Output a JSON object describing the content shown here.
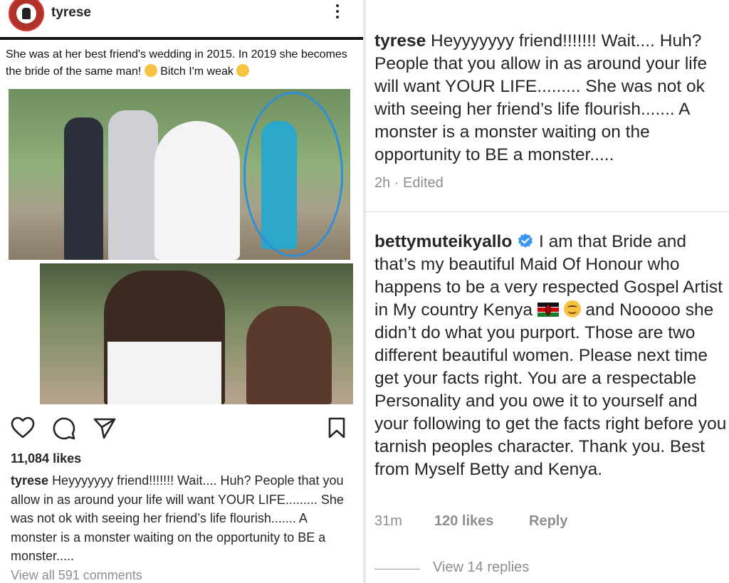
{
  "post": {
    "username": "tyrese",
    "meme_caption": "She was at her best friend's wedding in 2015. In 2019 she becomes the bride of the same man!",
    "meme_caption_tail": "Bitch I'm weak",
    "likes": "11,084 likes",
    "caption_username": "tyrese",
    "caption_text": "Heyyyyyyy friend!!!!!!! Wait.... Huh? People that you allow in as around  your life will want YOUR LIFE......... She was not ok with seeing her friend’s life flourish....... A monster is a monster waiting on the opportunity to BE a monster.....",
    "view_all_comments": "View all 591 comments",
    "icons": [
      "heart-icon",
      "comment-icon",
      "share-icon",
      "bookmark-icon",
      "more-icon"
    ]
  },
  "comment1": {
    "username": "tyrese",
    "text": "Heyyyyyyy friend!!!!!!! Wait.... Huh? People that you allow in as around  your life will want YOUR LIFE......... She was not ok with seeing her friend’s life flourish....... A monster is a monster waiting on the opportunity to BE a monster.....",
    "time": "2h",
    "edited": "Edited"
  },
  "comment2": {
    "username": "bettymuteikyallo",
    "text_a": "I am that Bride and that’s my beautiful Maid Of Honour who happens to be a very respected Gospel Artist in My country Kenya",
    "text_b": "and Nooooo she didn’t do what you purport. Those are two different beautiful women. Please next time get your facts right. You are a respectable Personality and you owe it to yourself and your following to get the facts right before you tarnish peoples character. Thank you.  Best from Myself Betty and Kenya.",
    "time": "31m",
    "likes": "120 likes",
    "reply": "Reply",
    "view_replies": "View 14 replies"
  },
  "colors": {
    "verified": "#3897f0",
    "muted": "#8e8e8e",
    "text": "#262626"
  }
}
